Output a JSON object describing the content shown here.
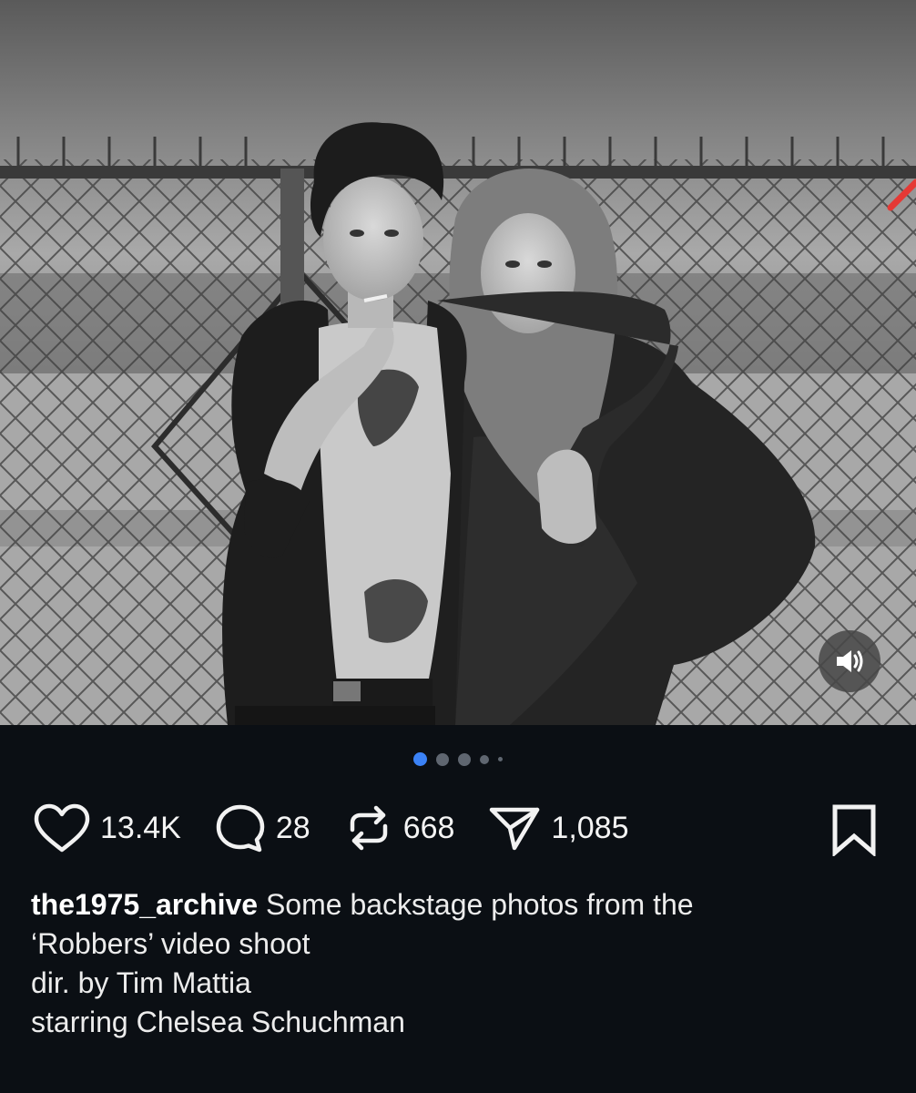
{
  "post": {
    "username": "the1975_archive",
    "caption_line1": "Some backstage photos from the",
    "caption_line2": "‘Robbers’ video shoot",
    "caption_line3": "dir. by Tim Mattia",
    "caption_line4": "starring Chelsea Schuchman"
  },
  "media": {
    "image_alt": "Black and white photo of a man and a woman posing in front of a chain-link fence",
    "sound_icon": "speaker-icon",
    "carousel_pages": 5,
    "carousel_active_index": 0
  },
  "actions": {
    "like": {
      "icon": "heart-icon",
      "count": "13.4K"
    },
    "comment": {
      "icon": "comment-bubble-icon",
      "count": "28"
    },
    "repost": {
      "icon": "repost-arrows-icon",
      "count": "668"
    },
    "share": {
      "icon": "paper-plane-icon",
      "count": "1,085"
    },
    "bookmark": {
      "icon": "bookmark-icon"
    }
  },
  "colors": {
    "background": "#0b0f14",
    "accent_dot": "#3b82f6",
    "inactive_dot": "#5f6670",
    "text": "#ececec",
    "red_mark": "#e53935"
  }
}
